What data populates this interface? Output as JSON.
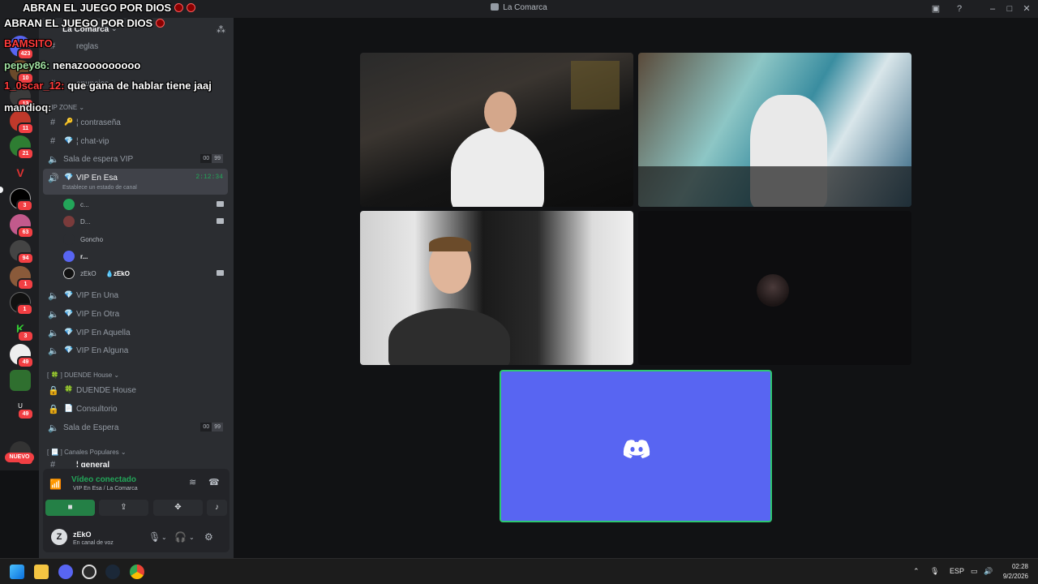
{
  "window": {
    "title": "La Comarca"
  },
  "overlay": {
    "top_messages": [
      "ABRAN EL JUEGO POR DIOS",
      "ABRAN EL JUEGO POR DIOS"
    ],
    "chat": [
      {
        "user": "BAMSITO",
        "text": ""
      },
      {
        "user": "pepey86:",
        "text": "nenazooooooooo"
      },
      {
        "user": "1_0scar_12:",
        "text": "que gana de hablar tiene jaaj"
      },
      {
        "user": "mandioq:",
        "text": ""
      }
    ]
  },
  "server": {
    "name": "La Comarca",
    "channels_top": [
      {
        "symbol": "#",
        "emoji": "",
        "label": "reglas"
      },
      {
        "symbol": "#",
        "emoji": "",
        "label": "anuncios"
      }
    ],
    "category_vip": "VIP ZONE",
    "vip_text_channels": [
      {
        "symbol": "#",
        "emoji": "🔑",
        "label": "¦ contraseña"
      },
      {
        "symbol": "#",
        "emoji": "💎",
        "label": "¦ chat-vip"
      }
    ],
    "waiting_vip": {
      "label": "Sala de espera VIP",
      "limit_a": "00",
      "limit_b": "99"
    },
    "active_channel": {
      "label": "VIP En Esa",
      "timer": "2:12:34",
      "status": "Establece un estado de canal"
    },
    "voice_users": [
      {
        "name": "c...",
        "camera": true
      },
      {
        "name": "D...",
        "camera": true
      },
      {
        "name": "Goncho",
        "camera": false
      },
      {
        "name": "r...",
        "camera": false
      },
      {
        "name": "zEkO",
        "tag": "zEkO",
        "camera": true
      }
    ],
    "vip_voice": [
      "VIP En Una",
      "VIP En Otra",
      "VIP En Aquella",
      "VIP En Alguna"
    ],
    "category_duende": "[ 🍀 ] DUENDE House",
    "duende_channels": [
      {
        "emoji": "🍀",
        "label": "DUENDE House"
      },
      {
        "emoji": "📄",
        "label": "Consultorio"
      }
    ],
    "waiting": {
      "label": "Sala de Espera",
      "limit_a": "00",
      "limit_b": "99"
    },
    "category_popular": "[ 📃 ] Canales Populares",
    "popular_partial": "¦ general"
  },
  "rail_badges": [
    "423",
    "10",
    "13",
    "11",
    "21",
    "3",
    "63",
    "94",
    "1",
    "1",
    "3",
    "49",
    "49",
    "1K+"
  ],
  "rail_new": "NUEVO",
  "voice_panel": {
    "status": "Vídeo conectado",
    "location": "VIP En Esa / La Comarca"
  },
  "user": {
    "name": "zEkO",
    "status": "En canal de voz",
    "avatar_letter": "Z"
  },
  "colors": {
    "blurple": "#5865f2",
    "green": "#23a559",
    "red": "#f23f43"
  },
  "taskbar": {
    "lang": "ESP",
    "time": "02:28",
    "date": "9/2/2026"
  }
}
